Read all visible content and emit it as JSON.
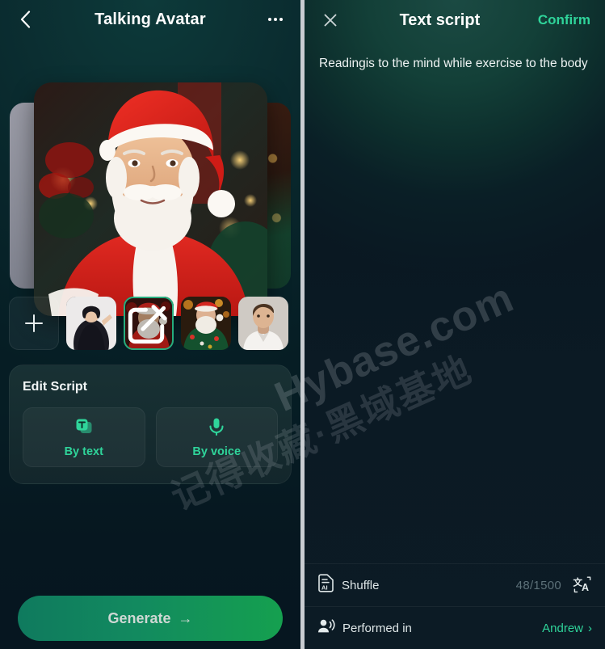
{
  "left_panel": {
    "header": {
      "back_icon": "chevron-left-icon",
      "title": "Talking Avatar",
      "more_icon": "more-horizontal-icon"
    },
    "carousel": {
      "selected_index": 2,
      "hero_alt": "Santa Claus portrait with red hat and white beard"
    },
    "thumbnails": [
      {
        "name": "add",
        "label": "+",
        "type": "add"
      },
      {
        "name": "woman-black-dress",
        "type": "image"
      },
      {
        "name": "santa-red-suit",
        "type": "image",
        "selected": true,
        "overlay_icon": "edit-square-icon"
      },
      {
        "name": "santa-green-sweater",
        "type": "image"
      },
      {
        "name": "man-white-shirt",
        "type": "image"
      }
    ],
    "edit_script": {
      "title": "Edit Script",
      "options": [
        {
          "label": "By text",
          "icon": "text-card-icon"
        },
        {
          "label": "By voice",
          "icon": "microphone-icon"
        }
      ]
    },
    "generate": {
      "label": "Generate",
      "arrow": "→"
    }
  },
  "right_panel": {
    "header": {
      "close_icon": "close-icon",
      "title": "Text script",
      "confirm_label": "Confirm"
    },
    "script_text": "Readingis to the mind while exercise to the body",
    "footer": {
      "shuffle": {
        "label": "Shuffle",
        "icon": "ai-doc-icon"
      },
      "counter": "48/1500",
      "translate_icon": "translate-icon",
      "performed": {
        "label": "Performed in",
        "icon": "voice-person-icon",
        "value": "Andrew",
        "chevron": "›"
      }
    }
  },
  "watermark": {
    "chinese": "记得收藏·黑域基地",
    "english": "Hybase.com"
  },
  "colors": {
    "accent_green": "#2fd49a",
    "panel_dark": "#0a1822",
    "divider": "#c9ccd1"
  }
}
